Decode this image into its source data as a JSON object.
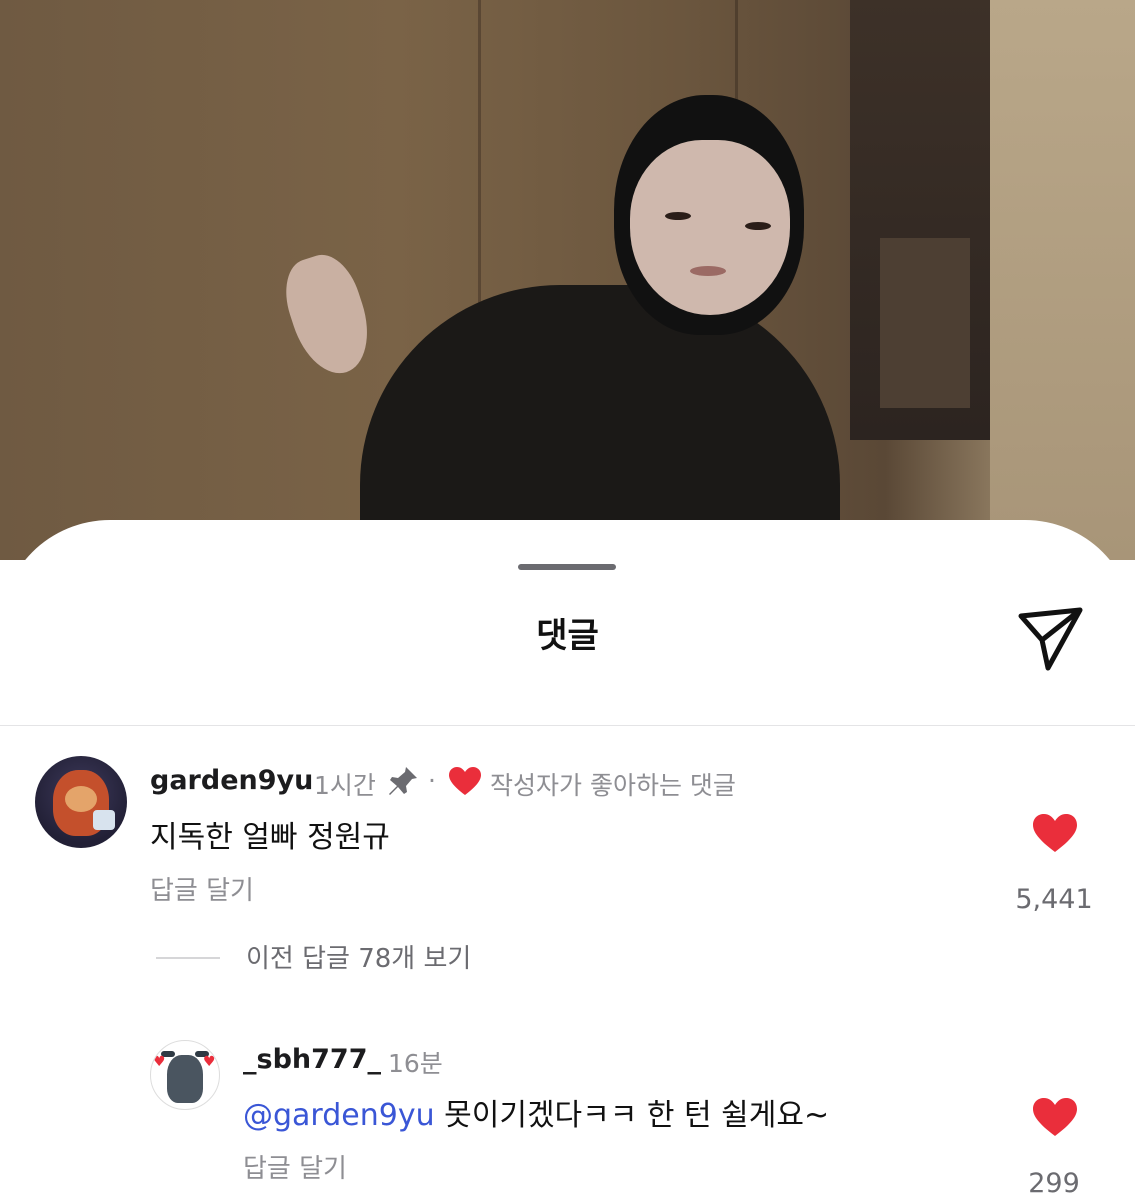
{
  "sheet": {
    "title": "댓글"
  },
  "comments": [
    {
      "username": "garden9yu",
      "time": "1시간",
      "separator": "·",
      "liked_by_author": "작성자가 좋아하는 댓글",
      "text": "지독한 얼빠 정원규",
      "reply_label": "답글 달기",
      "like_count": "5,441"
    }
  ],
  "view_previous_replies": "이전 답글 78개 보기",
  "replies": [
    {
      "username": "_sbh777_",
      "time": "16분",
      "mention": "@garden9yu",
      "text": " 못이기겠다ㅋㅋ 한 턴 쉴게요~",
      "reply_label": "답글 달기",
      "like_count": "299"
    }
  ],
  "colors": {
    "like_heart": "#ea2e3b",
    "mention": "#3a56d6",
    "secondary_text": "#8e8e93"
  },
  "icons": {
    "share": "paper-plane-icon",
    "pin": "pin-icon",
    "heart": "heart-icon"
  }
}
